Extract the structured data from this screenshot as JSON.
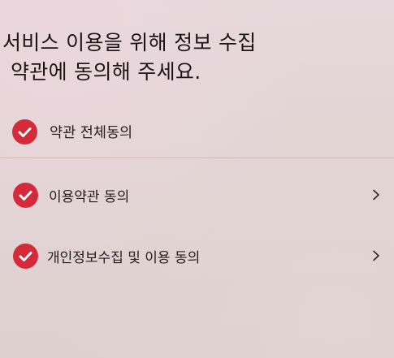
{
  "header": {
    "title_line1": "서비스 이용을 위해 정보 수집",
    "title_line2": "약관에 동의해 주세요."
  },
  "agreements": {
    "all": {
      "label": "약관 전체동의",
      "checked": true,
      "icon": "checkmark-circle-icon"
    },
    "items": [
      {
        "label": "이용약관 동의",
        "checked": true,
        "icon": "checkmark-circle-icon",
        "arrow": "chevron-right-icon"
      },
      {
        "label": "개인정보수집 및 이용 동의",
        "checked": true,
        "icon": "checkmark-circle-icon",
        "arrow": "chevron-right-icon"
      }
    ]
  },
  "colors": {
    "accent": "#d42a3a",
    "background": "#e2d5d6",
    "text": "#1f1b1b"
  }
}
